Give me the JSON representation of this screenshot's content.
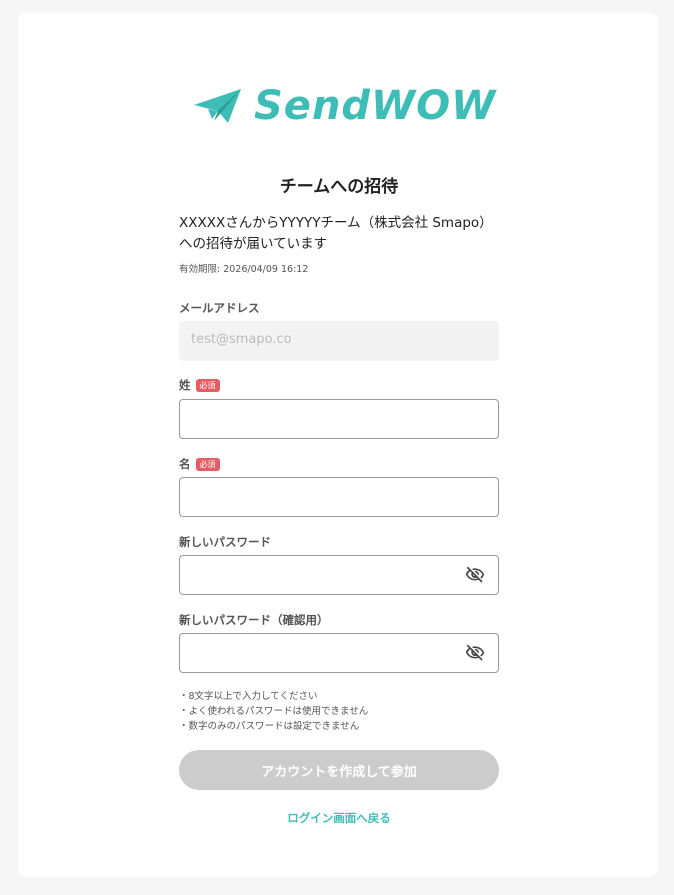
{
  "brand": {
    "name": "SendWOW",
    "color": "#3ebdb7",
    "icon": "paper-plane-icon"
  },
  "invite": {
    "title": "チームへの招待",
    "message": "XXXXXさんからYYYYYチーム（株式会社 Smapo）への招待が届いています",
    "expires": "有効期限: 2026/04/09 16:12"
  },
  "form": {
    "email_label": "メールアドレス",
    "email_value": "test@smapo.co",
    "last_name_label": "姓",
    "first_name_label": "名",
    "required_badge": "必須",
    "password_label": "新しいパスワード",
    "password_confirm_label": "新しいパスワード（確認用）",
    "toggle_icon": "eye-off-icon",
    "notes": [
      "・8文字以上で入力してください",
      "・よく使われるパスワードは使用できません",
      "・数字のみのパスワードは設定できません"
    ],
    "submit_label": "アカウントを作成して参加",
    "back_link": "ログイン画面へ戻る"
  }
}
